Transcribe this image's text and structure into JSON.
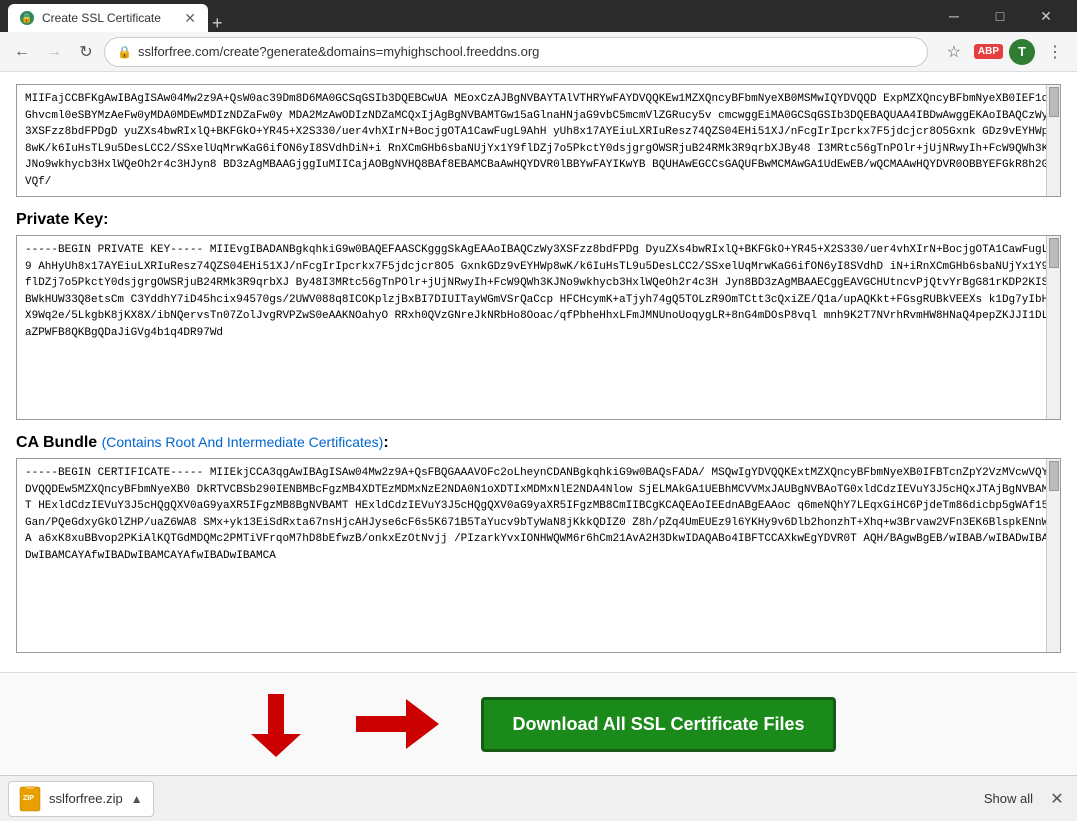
{
  "titlebar": {
    "tab_label": "Create SSL Certificate",
    "new_tab_label": "+",
    "minimize": "─",
    "restore": "□",
    "close": "✕"
  },
  "navbar": {
    "back": "←",
    "forward": "→",
    "refresh": "↻",
    "address": "sslforfree.com/create?generate&domains=myhighschool.freeddns.org",
    "address_domain": "sslforfree.com",
    "address_path": "/create?generate&domains=myhighschool.freeddns.org",
    "abp": "ABP",
    "profile": "T",
    "menu": "⋮",
    "star": "☆"
  },
  "sections": {
    "private_key_label": "Private Key:",
    "ca_bundle_label": "CA Bundle",
    "ca_bundle_contains": "(Contains Root And Intermediate Certificates)",
    "ca_bundle_colon": ":"
  },
  "cert_data": {
    "top_cert": "MIIFajCCBFKgAwIBAgISAw04Mw2z9A+QsW0ac39Dm8D6MA0GCSqGSIb3DQEBCwUA\nMEoxCzAJBgNVBAYTAlVTHRYwFAYDVQQKEw1MZXQncyBFbmNyeXB0MSMwIQYDVQQD\nExpMZXQncyBFbmNyeXB0IEF1dGhvcml0eSBYMzAeFw0yMDA0MDEwMDIzNDZaFw0y\nMDA2MzAwODIzNDZaMCQxIjAgBgNVBAMTGw15aGlnaHNjaG9vbC5mcmVlZGRucy5v\ncmcwggEiMA0GCSqGSIb3DQEBAQUAA4IBDwAwggEKAoIBAQCzWy3XSFzz8bdFPDgD\nyuZXs4bwRIxlQ+BKFGkO+YR45+X2S330/uer4vhXIrN+BocjgOTA1CawFugL9AhH\nyUh8x17AYEiuLXRIuResz74QZS04EHi51XJ/nFcgIrIpcrkx7F5jdcjcr8O5Gxnk\nGDz9vEYHWp8wK/k6IuHsTL9u5DesLCC2/SSxelUqMrwKaG6ifON6yI8SVdhDiN+i\nRnXCmGHb6sbaNUjYx1Y9flDZj7o5PkctY0dsjgrgOWSRjuB24RMk3R9qrbXJBy48\nI3MRtc56gTnPOlr+jUjNRwyIh+FcW9QWh3KJNo9wkhycb3HxlWQeOh2r4c3HJyn8\nBD3zAgMBAAGjggIuMIICajAOBgNVHQ8BAf8EBAMCBaAwHQYDVR0lBBYwFAYIKwYB\nBQUHAwEGCCsGAQUFBwMCMAwGA1UdEwEB/wQCMAAwHQYDVR0OBBYEFGkR8h2GVQf/",
    "private_key": "-----BEGIN PRIVATE KEY-----\nMIIEvgIBADANBgkqhkiG9w0BAQEFAASCKgggSkAgEAAoIBAQCzWy3XSFzz8bdFPDg\nDyuZXs4bwRIxlQ+BKFGkO+YR45+X2S330/uer4vhXIrN+BocjgOTA1CawFugL9\nAhHyUh8x17AYEiuLXRIuResz74QZS04EHi51XJ/nFcgIrIpcrkx7F5jdcjcr8O5\nGxnkGDz9vEYHWp8wK/k6IuHsTL9u5DesLCC2/SSxelUqMrwKaG6ifON6yI8SVdhD\niN+iRnXCmGHb6sbaNUjYx1Y9flDZj7o5PkctY0dsjgrgOWSRjuB24RMk3R9qrbXJ\nBy48I3MRtc56gTnPOlr+jUjNRwyIh+FcW9QWh3KJNo9wkhycb3HxlWQeOh2r4c3H\nJyn8BD3zAgMBAAECggEAVGCHUtncvPjQtvYrBgG81rKDP2KISBWkHUW33Q8etsCm\nC3YddhY7iD45hcix94570gs/2UWV088q8ICOKplzjBxBI7DIUITayWGmVSrQaCcp\nHFCHcymK+aTjyh74gQ5TOLzR9OmTCtt3cQxiZE/Q1a/upAQKkt+FGsgRUBkVEEXs\nk1Dg7yIbHX9Wq2e/5LkgbK8jKX8X/ibNQervsTn07ZolJvgRVPZwS0eAAKNOahyO\nRRxh0QVzGNreJkNRbHo8Ooac/qfPbheHhxLFmJMNUnoUoqygLR+8nG4mDOsP8vql\nmnh9K2T7NVrhRvmHW8HNaQ4pepZKJJI1DLaZPWFB8QKBgQDaJiGVg4b1q4DR97Wd",
    "ca_bundle": "-----BEGIN CERTIFICATE-----\nMIIEkjCCA3qgAwIBAgISAw04Mw2z9A+QsFBQGAAAVOFc2oLheynCDANBgkqhkiG9w0BAQsFADA/\nMSQwIgYDVQQKExtMZXQncyBFbmNyeXB0IFBTcnZpY2VzMVcwVQYDVQQDEw5MZXQncyBFbmNyeXB0\nDkRTVCBSb290IENBMBcFgzMB4XDTEzMDMxNzE2NDA0N1oXDTIxMDMxNlE2NDA4Nlow\nSjELMAkGA1UEBhMCVVMxJAUBgNVBAoTG0xldCdzIEVuY3J5cHQxJTAjBgNVBAMT\nHExldCdzIEVuY3J5cHQgQXV0aG9yaXR5IFgzMB8BgNVBAMT\nHExldCdzIEVuY3J5cHQgQXV0aG9yaXR5IFgzMB8CmIIBCgKCAQEAoIEEdnABgEAAoc\nq6meNQhY7LEqxGiHC6PjdeTm86dicbp5gWAf15Gan/PQeGdxyGkOlZHP/uaZ6WA8\nSMx+yk13EiSdRxta67nsHjcAHJyse6cF6s5K671B5TaYucv9bTyWaN8jKkkQDIZ0\nZ8h/pZq4UmEUEz9l6YKHy9v6Dlb2honzhT+Xhq+w3Brvaw2VFn3EK6BlspkENnWA\na6xK8xuBBvop2PKiAlKQTGdMDQMc2PMTiVFrqoM7hD8bEfwzB/onkxEzOtNvjj\n/PIzarkYvxIONHWQWM6r6hCm21AvA2H3DkwIDAQABo4IBFTCCAXkwEgYDVR0T\nAQH/BAgwBgEB/wIBAB/wIBADwIBADwIBAMCAYAfwIBADwIBAMCAYAfwIBADwIBAMCA"
  },
  "download": {
    "button_label": "Download All SSL Certificate Files",
    "file_name": "sslforfree.zip"
  },
  "bottom_bar": {
    "show_all": "Show all",
    "close": "✕"
  }
}
